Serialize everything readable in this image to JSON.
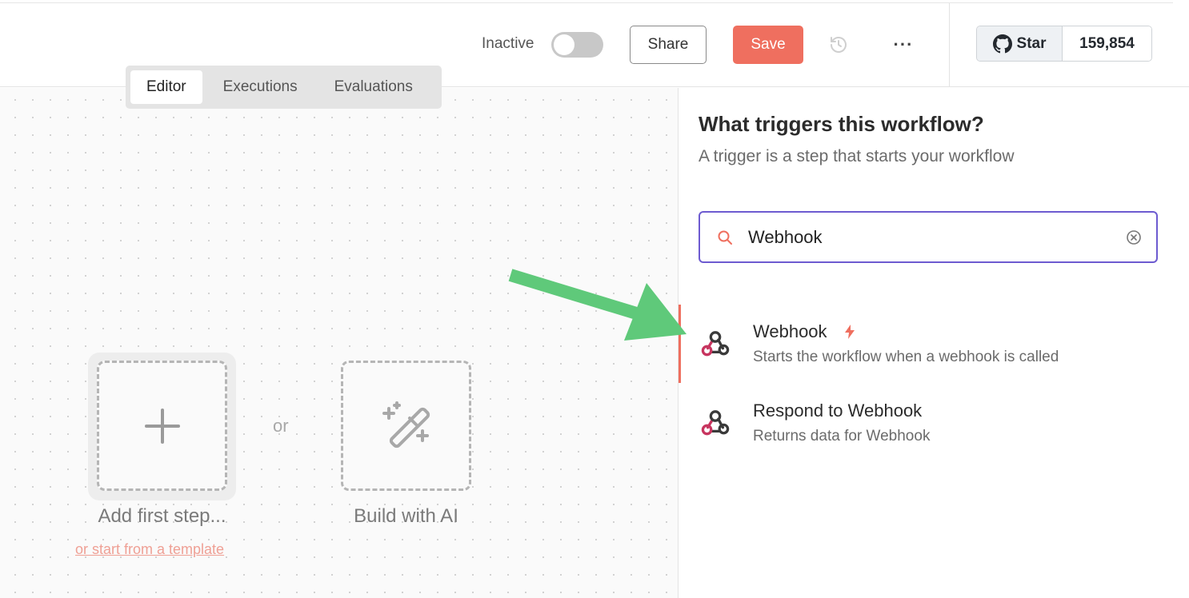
{
  "header": {
    "status_label": "Inactive",
    "share_label": "Share",
    "save_label": "Save",
    "github": {
      "star_label": "Star",
      "star_count": "159,854"
    }
  },
  "tabs": [
    {
      "label": "Editor",
      "active": true
    },
    {
      "label": "Executions",
      "active": false
    },
    {
      "label": "Evaluations",
      "active": false
    }
  ],
  "canvas": {
    "add_first_step_label": "Add first step...",
    "or_label": "or",
    "build_ai_label": "Build with AI",
    "template_link": "or start from a template"
  },
  "panel": {
    "title": "What triggers this workflow?",
    "subtitle": "A trigger is a step that starts your workflow",
    "search_value": "Webhook",
    "results": [
      {
        "title": "Webhook",
        "description": "Starts the workflow when a webhook is called",
        "icon": "webhook-icon",
        "trigger_badge": "bolt-icon"
      },
      {
        "title": "Respond to Webhook",
        "description": "Returns data for Webhook",
        "icon": "webhook-icon"
      }
    ]
  },
  "colors": {
    "accent": "#ef6f5f",
    "search_border": "#6d5bd0",
    "arrow": "#5fc97a",
    "webhook_pink": "#c7355f",
    "webhook_dark": "#3a3a3a"
  }
}
